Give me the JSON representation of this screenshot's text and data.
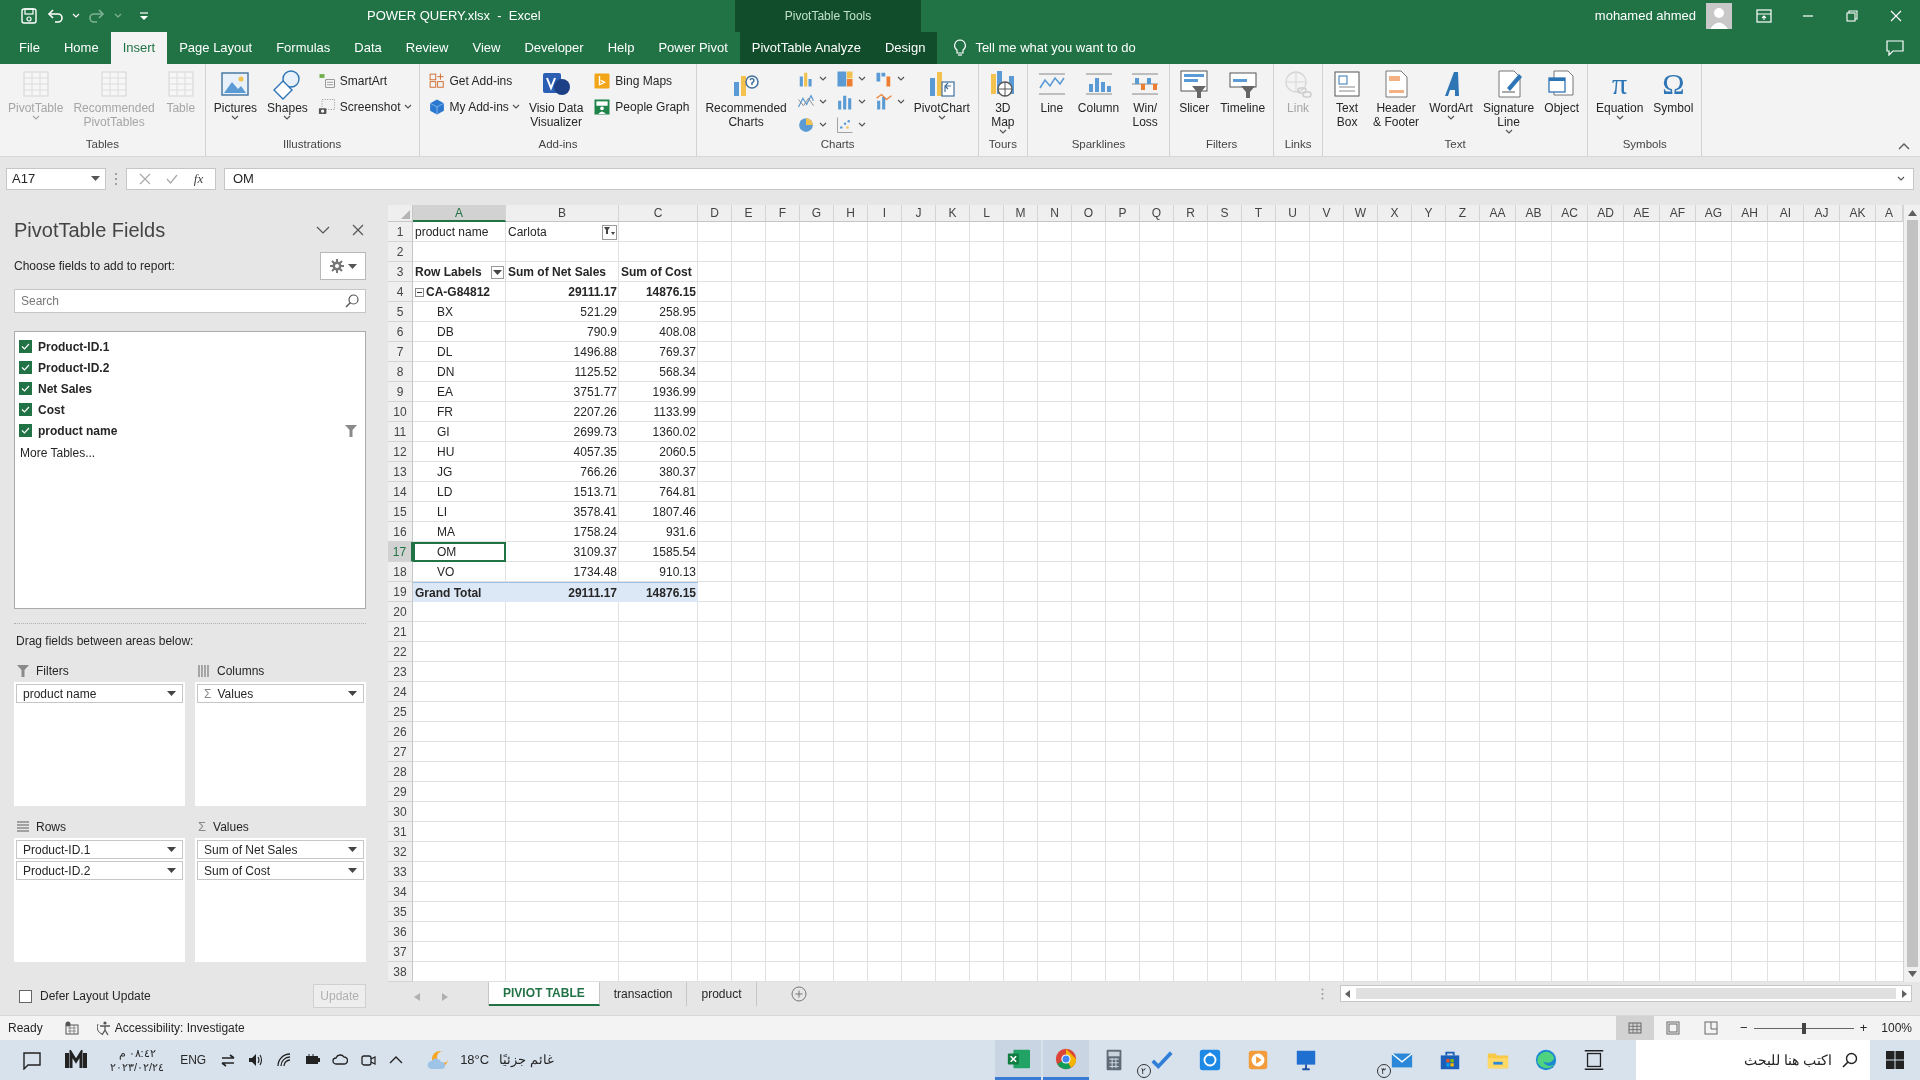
{
  "title_bar": {
    "title": "POWER QUERY.xlsx  -  Excel",
    "context": "PivotTable Tools",
    "user": "mohamed ahmed"
  },
  "ribbon_tabs": [
    {
      "label": "File",
      "selected": false,
      "contextual": false
    },
    {
      "label": "Home",
      "selected": false,
      "contextual": false
    },
    {
      "label": "Insert",
      "selected": true,
      "contextual": false
    },
    {
      "label": "Page Layout",
      "selected": false,
      "contextual": false
    },
    {
      "label": "Formulas",
      "selected": false,
      "contextual": false
    },
    {
      "label": "Data",
      "selected": false,
      "contextual": false
    },
    {
      "label": "Review",
      "selected": false,
      "contextual": false
    },
    {
      "label": "View",
      "selected": false,
      "contextual": false
    },
    {
      "label": "Developer",
      "selected": false,
      "contextual": false
    },
    {
      "label": "Help",
      "selected": false,
      "contextual": false
    },
    {
      "label": "Power Pivot",
      "selected": false,
      "contextual": false
    },
    {
      "label": "PivotTable Analyze",
      "selected": false,
      "contextual": true
    },
    {
      "label": "Design",
      "selected": false,
      "contextual": true
    }
  ],
  "tell_me": "Tell me what you want to do",
  "ribbon_groups": [
    {
      "label": "Tables",
      "buttons": [
        {
          "kind": "large",
          "label": "PivotTable",
          "disabled": true,
          "dropdown": true
        },
        {
          "kind": "large",
          "label": "Recommended\nPivotTables",
          "disabled": true,
          "dropdown": false
        },
        {
          "kind": "large",
          "label": "Table",
          "disabled": true,
          "dropdown": false
        }
      ]
    },
    {
      "label": "Illustrations",
      "buttons": [
        {
          "kind": "large",
          "label": "Pictures",
          "disabled": false,
          "dropdown": true
        },
        {
          "kind": "large",
          "label": "Shapes",
          "disabled": false,
          "dropdown": true
        },
        {
          "kind": "small",
          "label": "SmartArt",
          "disabled": false,
          "dropdown": false
        },
        {
          "kind": "small",
          "label": "Screenshot",
          "disabled": false,
          "dropdown": true
        }
      ]
    },
    {
      "label": "Add-ins",
      "buttons": [
        {
          "kind": "small",
          "label": "Get Add-ins",
          "disabled": false,
          "dropdown": false
        },
        {
          "kind": "small",
          "label": "My Add-ins",
          "disabled": false,
          "dropdown": true
        },
        {
          "kind": "large",
          "label": "Visio Data\nVisualizer",
          "disabled": false,
          "dropdown": false
        },
        {
          "kind": "small",
          "label": "Bing Maps",
          "disabled": false,
          "dropdown": false
        },
        {
          "kind": "small",
          "label": "People Graph",
          "disabled": false,
          "dropdown": false
        }
      ]
    },
    {
      "label": "Charts",
      "buttons": [
        {
          "kind": "large",
          "label": "Recommended\nCharts",
          "disabled": false,
          "dropdown": false
        },
        {
          "kind": "icon",
          "disabled": false,
          "dropdown": true
        },
        {
          "kind": "icon",
          "disabled": false,
          "dropdown": true
        },
        {
          "kind": "icon",
          "disabled": false,
          "dropdown": true
        },
        {
          "kind": "icon",
          "disabled": false,
          "dropdown": true
        },
        {
          "kind": "icon",
          "disabled": false,
          "dropdown": true
        },
        {
          "kind": "icon",
          "disabled": false,
          "dropdown": true
        },
        {
          "kind": "icon",
          "disabled": false,
          "dropdown": true
        },
        {
          "kind": "icon",
          "disabled": false,
          "dropdown": true
        },
        {
          "kind": "large",
          "label": "PivotChart",
          "disabled": false,
          "dropdown": true
        }
      ]
    },
    {
      "label": "Tours",
      "buttons": [
        {
          "kind": "large",
          "label": "3D\nMap",
          "disabled": false,
          "dropdown": true
        }
      ]
    },
    {
      "label": "Sparklines",
      "buttons": [
        {
          "kind": "large",
          "label": "Line",
          "disabled": false,
          "dropdown": false
        },
        {
          "kind": "large",
          "label": "Column",
          "disabled": false,
          "dropdown": false
        },
        {
          "kind": "large",
          "label": "Win/\nLoss",
          "disabled": false,
          "dropdown": false
        }
      ]
    },
    {
      "label": "Filters",
      "buttons": [
        {
          "kind": "large",
          "label": "Slicer",
          "disabled": false,
          "dropdown": false
        },
        {
          "kind": "large",
          "label": "Timeline",
          "disabled": false,
          "dropdown": false
        }
      ]
    },
    {
      "label": "Links",
      "buttons": [
        {
          "kind": "large",
          "label": "Link",
          "disabled": true,
          "dropdown": false
        }
      ]
    },
    {
      "label": "Text",
      "buttons": [
        {
          "kind": "large",
          "label": "Text\nBox",
          "disabled": false,
          "dropdown": false
        },
        {
          "kind": "large",
          "label": "Header\n& Footer",
          "disabled": false,
          "dropdown": false
        },
        {
          "kind": "large",
          "label": "WordArt",
          "disabled": false,
          "dropdown": true
        },
        {
          "kind": "large",
          "label": "Signature\nLine",
          "disabled": false,
          "dropdown": true
        },
        {
          "kind": "large",
          "label": "Object",
          "disabled": false,
          "dropdown": false
        }
      ]
    },
    {
      "label": "Symbols",
      "buttons": [
        {
          "kind": "glyph",
          "glyph": "π",
          "label": "Equation",
          "disabled": false,
          "dropdown": true
        },
        {
          "kind": "glyph",
          "glyph": "Ω",
          "label": "Symbol",
          "disabled": false,
          "dropdown": false
        }
      ]
    }
  ],
  "formula_bar": {
    "name_box": "A17",
    "fx": "fx",
    "value": "OM"
  },
  "pivot_panel": {
    "title": "PivotTable Fields",
    "prompt": "Choose fields to add to report:",
    "search_placeholder": "Search",
    "fields": [
      {
        "label": "Product-ID.1",
        "checked": true,
        "filtered": false
      },
      {
        "label": "Product-ID.2",
        "checked": true,
        "filtered": false
      },
      {
        "label": "Net Sales",
        "checked": true,
        "filtered": false
      },
      {
        "label": "Cost",
        "checked": true,
        "filtered": false
      },
      {
        "label": "product name",
        "checked": true,
        "filtered": true
      }
    ],
    "more_tables": "More Tables...",
    "areas_prompt": "Drag fields between areas below:",
    "areas": [
      {
        "kind": "filters",
        "title": "Filters",
        "items": [
          {
            "label": "product name"
          }
        ]
      },
      {
        "kind": "columns",
        "title": "Columns",
        "items": [
          {
            "symbol": "Σ",
            "label": "Values"
          }
        ]
      },
      {
        "kind": "rows",
        "title": "Rows",
        "items": [
          {
            "label": "Product-ID.1"
          },
          {
            "label": "Product-ID.2"
          }
        ]
      },
      {
        "kind": "values",
        "title": "Values",
        "symbol": "Σ",
        "items": [
          {
            "label": "Sum of Net Sales"
          },
          {
            "label": "Sum of Cost"
          }
        ]
      }
    ],
    "defer": {
      "label": "Defer Layout Update",
      "checked": false
    },
    "update": {
      "label": "Update",
      "disabled": true
    }
  },
  "sheet": {
    "columns": [
      {
        "label": "A",
        "selected": true
      },
      {
        "label": "B",
        "selected": false
      },
      {
        "label": "C",
        "selected": false
      },
      {
        "label": "D",
        "selected": false
      },
      {
        "label": "E",
        "selected": false
      },
      {
        "label": "F",
        "selected": false
      },
      {
        "label": "G",
        "selected": false
      },
      {
        "label": "H",
        "selected": false
      },
      {
        "label": "I",
        "selected": false
      },
      {
        "label": "J",
        "selected": false
      },
      {
        "label": "K",
        "selected": false
      },
      {
        "label": "L",
        "selected": false
      },
      {
        "label": "M",
        "selected": false
      },
      {
        "label": "N",
        "selected": false
      },
      {
        "label": "O",
        "selected": false
      },
      {
        "label": "P",
        "selected": false
      },
      {
        "label": "Q",
        "selected": false
      },
      {
        "label": "R",
        "selected": false
      },
      {
        "label": "S",
        "selected": false
      },
      {
        "label": "T",
        "selected": false
      },
      {
        "label": "U",
        "selected": false
      },
      {
        "label": "V",
        "selected": false
      },
      {
        "label": "W",
        "selected": false
      },
      {
        "label": "X",
        "selected": false
      },
      {
        "label": "Y",
        "selected": false
      },
      {
        "label": "Z",
        "selected": false
      },
      {
        "label": "AA",
        "selected": false
      },
      {
        "label": "AB",
        "selected": false
      },
      {
        "label": "AC",
        "selected": false
      },
      {
        "label": "AD",
        "selected": false
      },
      {
        "label": "AE",
        "selected": false
      },
      {
        "label": "AF",
        "selected": false
      },
      {
        "label": "AG",
        "selected": false
      },
      {
        "label": "AH",
        "selected": false
      },
      {
        "label": "AI",
        "selected": false
      },
      {
        "label": "AJ",
        "selected": false
      },
      {
        "label": "AK",
        "selected": false
      },
      {
        "label": "A",
        "selected": false
      }
    ],
    "rows": [
      {
        "number": "1",
        "selected": false,
        "cells": [
          {
            "text": "product name",
            "kind": "plain"
          },
          {
            "text": "Carlota",
            "kind": "filter"
          }
        ]
      },
      {
        "number": "2",
        "selected": false
      },
      {
        "number": "3",
        "selected": false,
        "cells": [
          {
            "text": "Row Labels",
            "kind": "header_dropdown"
          },
          {
            "text": "Sum of Net Sales",
            "kind": "header"
          },
          {
            "text": "Sum of Cost",
            "kind": "header"
          }
        ]
      },
      {
        "number": "4",
        "selected": false,
        "cells": [
          {
            "text": "CA-G84812",
            "kind": "group"
          },
          {
            "text": "29111.17",
            "kind": "group_value"
          },
          {
            "text": "14876.15",
            "kind": "group_value"
          }
        ]
      },
      {
        "number": "5",
        "selected": false,
        "cells": [
          {
            "text": "BX",
            "kind": "item"
          },
          {
            "text": "521.29",
            "kind": "value"
          },
          {
            "text": "258.95",
            "kind": "value"
          }
        ]
      },
      {
        "number": "6",
        "selected": false,
        "cells": [
          {
            "text": "DB",
            "kind": "item"
          },
          {
            "text": "790.9",
            "kind": "value"
          },
          {
            "text": "408.08",
            "kind": "value"
          }
        ]
      },
      {
        "number": "7",
        "selected": false,
        "cells": [
          {
            "text": "DL",
            "kind": "item"
          },
          {
            "text": "1496.88",
            "kind": "value"
          },
          {
            "text": "769.37",
            "kind": "value"
          }
        ]
      },
      {
        "number": "8",
        "selected": false,
        "cells": [
          {
            "text": "DN",
            "kind": "item"
          },
          {
            "text": "1125.52",
            "kind": "value"
          },
          {
            "text": "568.34",
            "kind": "value"
          }
        ]
      },
      {
        "number": "9",
        "selected": false,
        "cells": [
          {
            "text": "EA",
            "kind": "item"
          },
          {
            "text": "3751.77",
            "kind": "value"
          },
          {
            "text": "1936.99",
            "kind": "value"
          }
        ]
      },
      {
        "number": "10",
        "selected": false,
        "cells": [
          {
            "text": "FR",
            "kind": "item"
          },
          {
            "text": "2207.26",
            "kind": "value"
          },
          {
            "text": "1133.99",
            "kind": "value"
          }
        ]
      },
      {
        "number": "11",
        "selected": false,
        "cells": [
          {
            "text": "GI",
            "kind": "item"
          },
          {
            "text": "2699.73",
            "kind": "value"
          },
          {
            "text": "1360.02",
            "kind": "value"
          }
        ]
      },
      {
        "number": "12",
        "selected": false,
        "cells": [
          {
            "text": "HU",
            "kind": "item"
          },
          {
            "text": "4057.35",
            "kind": "value"
          },
          {
            "text": "2060.5",
            "kind": "value"
          }
        ]
      },
      {
        "number": "13",
        "selected": false,
        "cells": [
          {
            "text": "JG",
            "kind": "item"
          },
          {
            "text": "766.26",
            "kind": "value"
          },
          {
            "text": "380.37",
            "kind": "value"
          }
        ]
      },
      {
        "number": "14",
        "selected": false,
        "cells": [
          {
            "text": "LD",
            "kind": "item"
          },
          {
            "text": "1513.71",
            "kind": "value"
          },
          {
            "text": "764.81",
            "kind": "value"
          }
        ]
      },
      {
        "number": "15",
        "selected": false,
        "cells": [
          {
            "text": "LI",
            "kind": "item"
          },
          {
            "text": "3578.41",
            "kind": "value"
          },
          {
            "text": "1807.46",
            "kind": "value"
          }
        ]
      },
      {
        "number": "16",
        "selected": false,
        "cells": [
          {
            "text": "MA",
            "kind": "item"
          },
          {
            "text": "1758.24",
            "kind": "value"
          },
          {
            "text": "931.6",
            "kind": "value"
          }
        ]
      },
      {
        "number": "17",
        "selected": true,
        "cells": [
          {
            "text": "OM",
            "kind": "item"
          },
          {
            "text": "3109.37",
            "kind": "value"
          },
          {
            "text": "1585.54",
            "kind": "value"
          }
        ]
      },
      {
        "number": "18",
        "selected": false,
        "cells": [
          {
            "text": "VO",
            "kind": "item"
          },
          {
            "text": "1734.48",
            "kind": "value"
          },
          {
            "text": "910.13",
            "kind": "value"
          }
        ]
      },
      {
        "number": "19",
        "selected": false,
        "cells": [
          {
            "text": "Grand Total",
            "kind": "total_label"
          },
          {
            "text": "29111.17",
            "kind": "total_value"
          },
          {
            "text": "14876.15",
            "kind": "total_value"
          }
        ]
      },
      {
        "number": "20",
        "selected": false
      },
      {
        "number": "21",
        "selected": false
      },
      {
        "number": "22",
        "selected": false
      },
      {
        "number": "23",
        "selected": false
      },
      {
        "number": "24",
        "selected": false
      },
      {
        "number": "25",
        "selected": false
      },
      {
        "number": "26",
        "selected": false
      },
      {
        "number": "27",
        "selected": false
      },
      {
        "number": "28",
        "selected": false
      },
      {
        "number": "29",
        "selected": false
      },
      {
        "number": "30",
        "selected": false
      },
      {
        "number": "31",
        "selected": false
      },
      {
        "number": "32",
        "selected": false
      },
      {
        "number": "33",
        "selected": false
      },
      {
        "number": "34",
        "selected": false
      },
      {
        "number": "35",
        "selected": false
      },
      {
        "number": "36",
        "selected": false
      },
      {
        "number": "37",
        "selected": false
      },
      {
        "number": "38",
        "selected": false
      }
    ]
  },
  "sheet_tabs": [
    {
      "label": "PIVIOT TABLE",
      "selected": true
    },
    {
      "label": "transaction",
      "selected": false
    },
    {
      "label": "product",
      "selected": false
    }
  ],
  "status_bar": {
    "ready": "Ready",
    "accessibility": "Accessibility: Investigate",
    "views": [
      {
        "selected": true
      },
      {
        "selected": false
      },
      {
        "selected": false
      }
    ],
    "zoom": {
      "minus": "−",
      "plus": "+",
      "level": 0.5,
      "reading": "100%"
    }
  },
  "taskbar": {
    "clock_time": "٠٨:٤٢ م",
    "clock_date": "٢٠٢٣/٠٢/٢٤",
    "language": "ENG",
    "temperature": "18°C",
    "weather": "غائم جزئيًا",
    "apps": [
      {
        "active": true
      },
      {
        "active": true
      },
      {
        "active": false
      },
      {
        "active": false,
        "badge": "٢"
      },
      {
        "active": false
      },
      {
        "active": false
      },
      {
        "active": false
      }
    ],
    "more_apps": [
      {
        "active": false,
        "badge": "٣"
      },
      {
        "active": false
      },
      {
        "active": false
      },
      {
        "active": false
      },
      {
        "active": false
      }
    ],
    "search_placeholder": "اكتب هنا للبحث"
  }
}
